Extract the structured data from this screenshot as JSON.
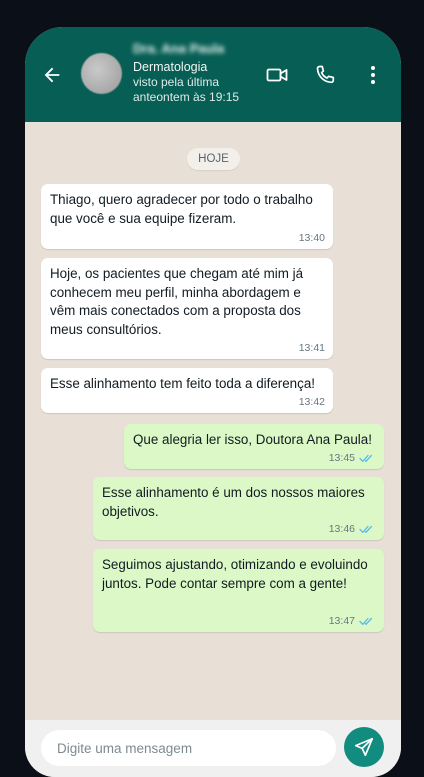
{
  "header": {
    "contact_name": "Dra. Ana Paula",
    "contact_subtitle": "Dermatologia",
    "status_line1": "visto pela última",
    "status_line2": "anteontem às 19:15"
  },
  "chat": {
    "date_label": "HOJE",
    "messages": [
      {
        "direction": "incoming",
        "text": "Thiago, quero agradecer por todo o trabalho que você e sua equipe fizeram.",
        "time": "13:40"
      },
      {
        "direction": "incoming",
        "text": "Hoje, os pacientes que chegam até mim já conhecem meu perfil, minha abordagem e vêm mais conectados com a proposta dos meus consultórios.",
        "time": "13:41"
      },
      {
        "direction": "incoming",
        "text": "Esse alinhamento tem feito toda a diferença!",
        "time": "13:42"
      },
      {
        "direction": "outgoing",
        "text": "Que alegria ler isso, Doutora Ana Paula!",
        "time": "13:45",
        "status": "read"
      },
      {
        "direction": "outgoing",
        "text": "Esse alinhamento é um dos nossos maiores objetivos.",
        "time": "13:46",
        "status": "read"
      },
      {
        "direction": "outgoing",
        "text": "Seguimos ajustando, otimizando e evoluindo juntos. Pode contar sempre com a gente!",
        "time": "13:47",
        "status": "read"
      }
    ]
  },
  "composer": {
    "placeholder": "Digite uma mensagem",
    "value": ""
  },
  "colors": {
    "header_bg": "#075e54",
    "chat_bg": "#e8e0d7",
    "incoming_bubble": "#ffffff",
    "outgoing_bubble": "#dcf8c6",
    "read_ticks": "#53bdeb",
    "send_button": "#128c7e"
  },
  "icons": {
    "back": "arrow-left-icon",
    "video": "video-camera-icon",
    "call": "phone-icon",
    "menu": "more-vertical-icon",
    "read": "double-check-icon",
    "send": "send-icon"
  }
}
